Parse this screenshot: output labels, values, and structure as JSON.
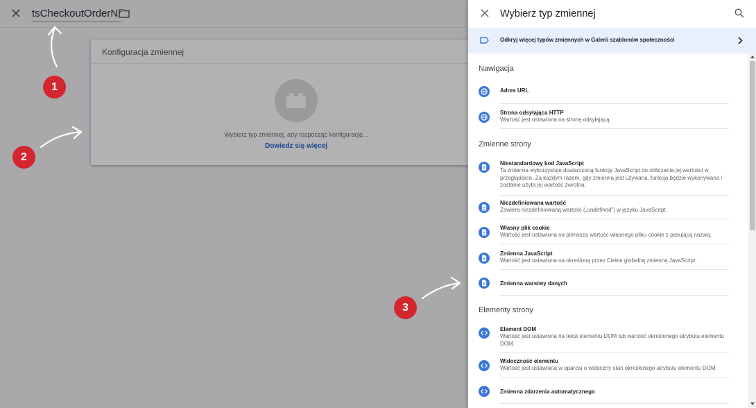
{
  "editor": {
    "variable_name": "tsCheckoutOrderNr",
    "config_title": "Konfiguracja zmiennej",
    "config_hint": "Wybierz typ zmiennej, aby rozpocząć konfigurację...",
    "config_link": "Dowiedz się więcej"
  },
  "annotations": {
    "b1": "1",
    "b2": "2",
    "b3": "3"
  },
  "panel": {
    "title": "Wybierz typ zmiennej",
    "gallery_text": "Odkryj więcej typów zmiennych w Galerii szablonów społeczności",
    "sections": [
      {
        "title": "Nawigacja",
        "items": [
          {
            "title": "Adres URL",
            "desc": "",
            "icon": "globe-icon"
          },
          {
            "title": "Strona odsyłająca HTTP",
            "desc": "Wartość jest ustawiona na stronę odsyłającą.",
            "icon": "globe-icon"
          }
        ]
      },
      {
        "title": "Zmienne strony",
        "items": [
          {
            "title": "Niestandardowy kod JavaScript",
            "desc": "Ta zmienna wykorzystuje dostarczoną funkcję JavaScript do obliczenia jej wartości w przeglądarce. Za każdym razem, gdy zmienna jest używana, funkcja będzie wykonywana i zostanie użyta jej wartość zwrotna.",
            "icon": "document-icon"
          },
          {
            "title": "Niezdefiniowana wartość",
            "desc": "Zawiera niezdefiniowaną wartość („undefined\") w języku JavaScript.",
            "icon": "document-icon"
          },
          {
            "title": "Własny plik cookie",
            "desc": "Wartość jest ustawiona na pierwszą wartość własnego pliku cookie z pasującą nazwą.",
            "icon": "document-icon"
          },
          {
            "title": "Zmienna JavaScript",
            "desc": "Wartość jest ustawiona na określoną przez Ciebie globalną zmienną JavaScript.",
            "icon": "document-icon"
          },
          {
            "title": "Zmienna warstwy danych",
            "desc": "",
            "icon": "document-icon"
          }
        ]
      },
      {
        "title": "Elementy strony",
        "items": [
          {
            "title": "Element DOM",
            "desc": "Wartość jest ustawiona na tekst elementu DOM lub wartość określonego atrybutu elementu DOM.",
            "icon": "code-icon"
          },
          {
            "title": "Widoczność elementu",
            "desc": "Wartość jest ustawiana w oparciu o widoczny stan określonego atrybutu elementu DOM.",
            "icon": "code-icon"
          },
          {
            "title": "Zmienna zdarzenia automatycznego",
            "desc": "",
            "icon": "code-icon"
          }
        ]
      }
    ]
  },
  "colors": {
    "accent": "#3a78d8",
    "badge": "#d4262e",
    "banner": "#e8f0fe",
    "overlay": "#a9a9ac"
  }
}
